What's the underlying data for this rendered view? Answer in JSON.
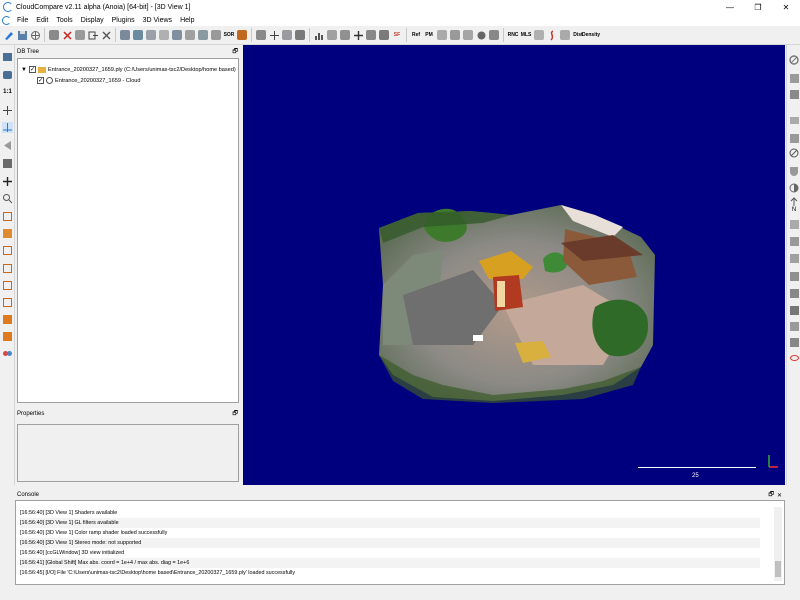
{
  "window": {
    "title": "CloudCompare v2.11 alpha (Anoia) [64-bit] - [3D View 1]",
    "controls": [
      "—",
      "❐",
      "✕"
    ]
  },
  "menu": [
    "File",
    "Edit",
    "Tools",
    "Display",
    "Plugins",
    "3D Views",
    "Help"
  ],
  "toolbar": {
    "sor_label": "SOR",
    "sf_label": "SF",
    "ref_label": "Ref",
    "pm_label": "PM",
    "vnc_label": "RNC",
    "mls_label": "MLS",
    "dist_label": "Dist",
    "density_label": "Density"
  },
  "db_tree": {
    "title": "DB Tree",
    "root_label": "Entrance_20200327_1659.ply (C:/Users/unimas-tsc2/Desktop/home based)",
    "child_label": "Entrance_20200327_1659 - Cloud"
  },
  "properties": {
    "title": "Properties"
  },
  "view3d": {
    "scale_value": "25",
    "background_color": "#00007f"
  },
  "console": {
    "title": "Console",
    "lines": [
      "[16:56:40] [3D View 1] Shaders available",
      "[16:56:40] [3D View 1] GL filters available",
      "[16:56:40] [3D View 1] Color ramp shader loaded successfully",
      "[16:56:40] [3D View 1] Stereo mode: not supported",
      "[16:56:40] [ccGLWindow] 3D view initialized",
      "[16:56:41] [Global Shift] Max abs. coord = 1e+4 / max abs. diag = 1e+6",
      "[16:56:45] [I/O] File 'C:\\Users\\unimas-tsc2\\Desktop\\home based\\Entrance_20200327_1659.ply' loaded successfully"
    ]
  },
  "float_icon": "🗗"
}
